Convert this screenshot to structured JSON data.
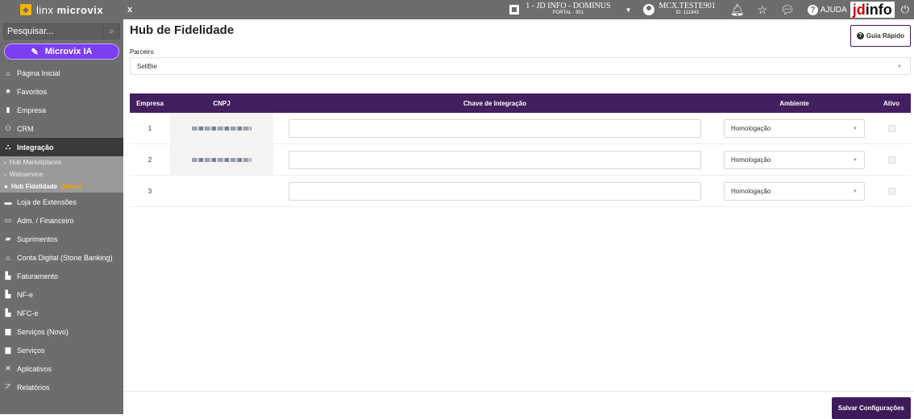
{
  "topbar": {
    "brand_prefix": "linx",
    "brand_name": "microvix",
    "close_label": "x",
    "company_name": "1 - JD INFO - DOMINUS",
    "company_sub": "PORTAL - 901",
    "user_name": "MCX.TESTE901",
    "user_id": "ID: 111943",
    "help_label": "AJUDA",
    "logo_jd": "jd",
    "logo_info": "info"
  },
  "sidebar": {
    "search_placeholder": "Pesquisar...",
    "ia_label": "Microvix IA",
    "items_top": [
      {
        "label": "Página Inicial",
        "icon": "home-icon"
      },
      {
        "label": "Favoritos",
        "icon": "star-icon"
      },
      {
        "label": "Empresa",
        "icon": "building-icon"
      },
      {
        "label": "CRM",
        "icon": "users-icon"
      },
      {
        "label": "Integração",
        "icon": "sitemap-icon"
      }
    ],
    "subitems": [
      {
        "label": "Hub Marketplaces"
      },
      {
        "label": "Webservice"
      },
      {
        "label": "Hub Fidelidade",
        "badge": "(Novo)"
      }
    ],
    "items_bottom": [
      {
        "label": "Loja de Extensões",
        "icon": "store-icon"
      },
      {
        "label": "Adm. / Financeiro",
        "icon": "money-icon"
      },
      {
        "label": "Suprimentos",
        "icon": "truck-icon"
      },
      {
        "label": "Conta Digital (Stone Banking)",
        "icon": "bank-icon"
      },
      {
        "label": "Faturamento",
        "icon": "document-icon"
      },
      {
        "label": "NF-e",
        "icon": "document-icon"
      },
      {
        "label": "NFC-e",
        "icon": "document-icon"
      },
      {
        "label": "Serviços (Novo)",
        "icon": "briefcase-icon"
      },
      {
        "label": "Serviços",
        "icon": "briefcase-icon"
      },
      {
        "label": "Aplicativos",
        "icon": "puzzle-icon"
      },
      {
        "label": "Relatórios",
        "icon": "chart-icon"
      }
    ]
  },
  "main": {
    "title": "Hub de Fidelidade",
    "guide_label": "Guia Rápido",
    "partner_label": "Parceiro",
    "partner_value": "SellBie",
    "columns": {
      "empresa": "Empresa",
      "cnpj": "CNPJ",
      "chave": "Chave de Integração",
      "ambiente": "Ambiente",
      "ativo": "Ativo"
    },
    "rows": [
      {
        "empresa": "1",
        "ambiente": "Homologação"
      },
      {
        "empresa": "2",
        "ambiente": "Homologação"
      },
      {
        "empresa": "3",
        "ambiente": "Homologação"
      }
    ],
    "save_label": "Salvar Configurações"
  },
  "colors": {
    "sidebar_bg": "#6d6d6d",
    "accent_purple": "#431f60",
    "ia_button": "#7b3ff2",
    "badge_orange": "#f3a300",
    "logo_red": "#d30000"
  }
}
